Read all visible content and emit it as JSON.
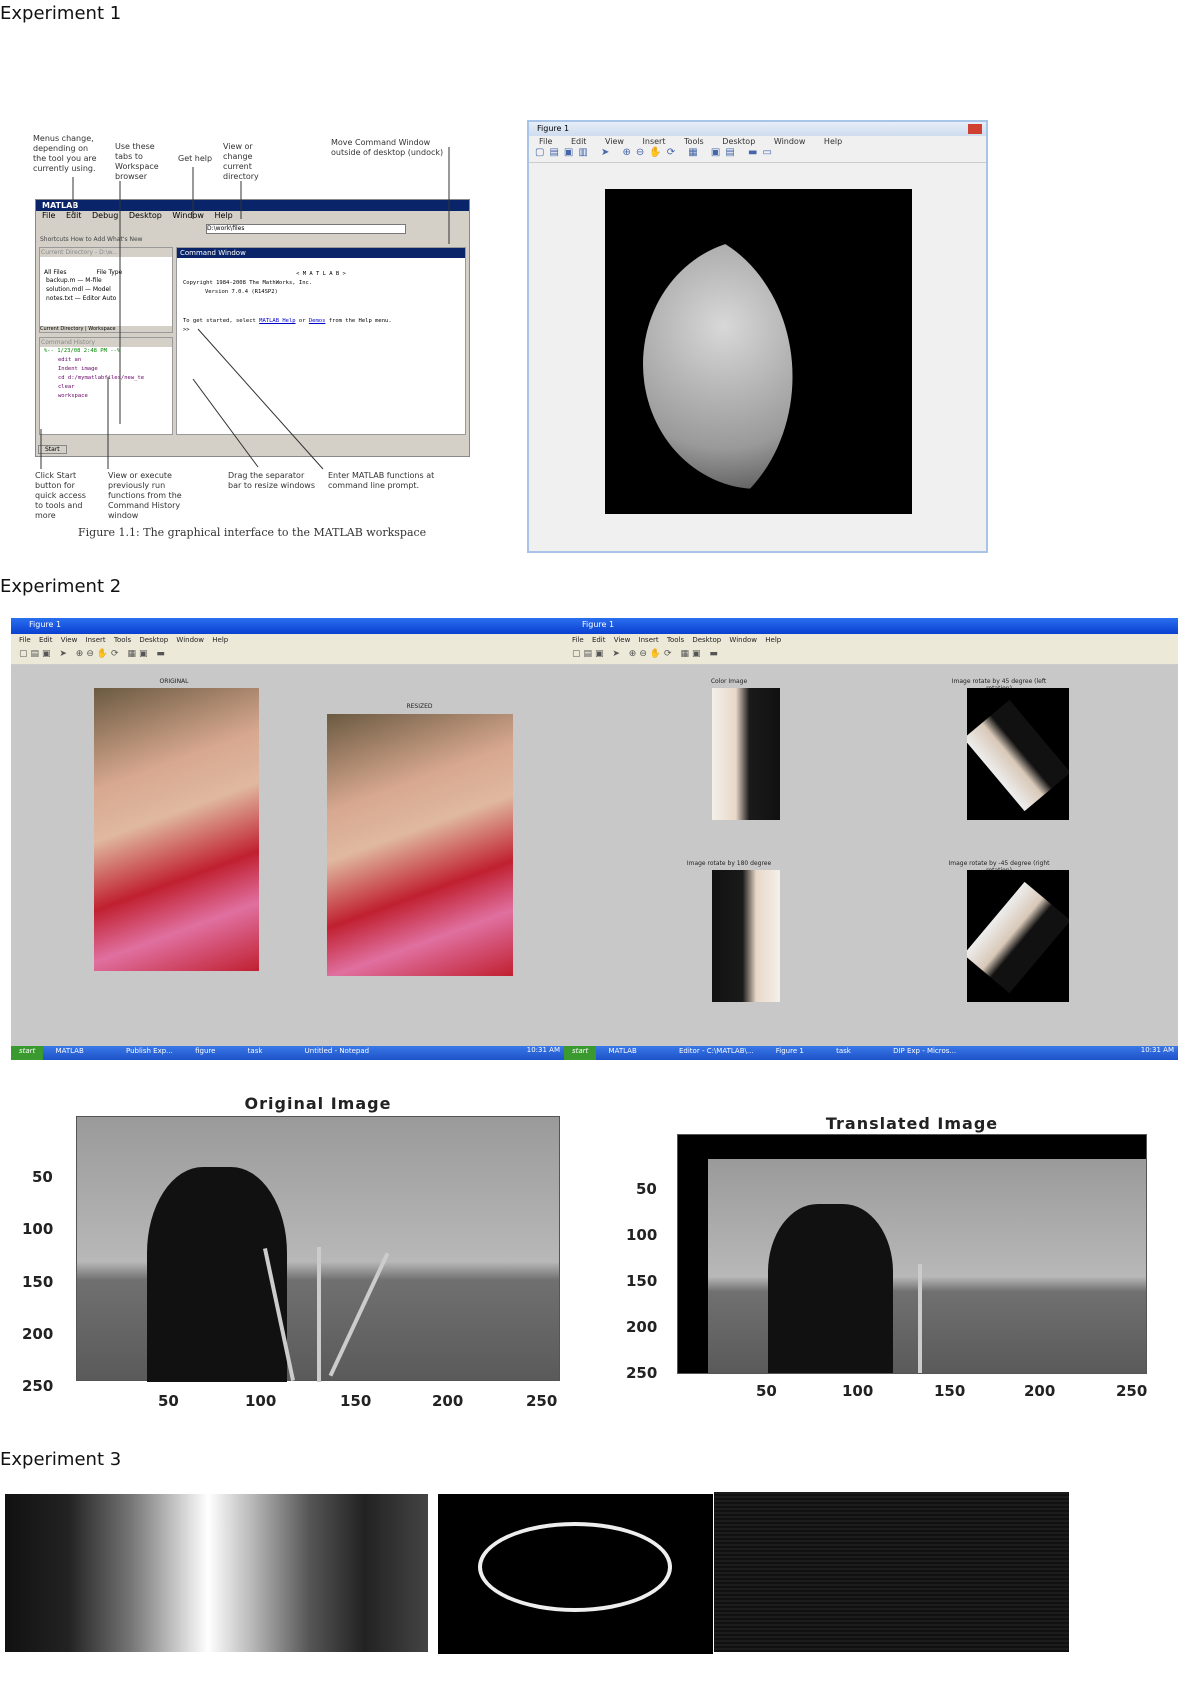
{
  "exp1": {
    "heading": "Experiment 1",
    "figure_caption": "Figure 1.1: The graphical interface to the MATLAB workspace",
    "annotations": [
      "Menus change, depending on the tool you are currently using.",
      "Use these tabs to Workspace browser",
      "Get help",
      "View or change current directory",
      "Move Command Window outside of desktop (undock)",
      "Click Start button for quick access to tools and more",
      "View or execute previously run functions from the Command History window",
      "Drag the separator bar to resize windows",
      "Enter MATLAB functions at command line prompt."
    ],
    "matlab": {
      "title": "MATLAB",
      "menus": [
        "File",
        "Edit",
        "Debug",
        "Desktop",
        "Window",
        "Help"
      ],
      "current_dir": "D:\\work\\files",
      "shortcuts": "Shortcuts  How to Add  What's New",
      "current_directory_title": "Current Directory - D:\\w...",
      "files_header": [
        "All Files",
        "File Type"
      ],
      "files": [
        [
          "backup.m",
          "M-file"
        ],
        [
          "solution.mdl",
          "Model"
        ],
        [
          "notes.txt",
          "Editor Auto"
        ]
      ],
      "tabs": [
        "Current Directory",
        "Workspace"
      ],
      "history_title": "Command History",
      "history": [
        "%-- 1/23/08  2:48 PM --%",
        "edit an",
        "Indent image",
        "cd d:/mymatlabfiles/new_te",
        "clear",
        "workspace"
      ],
      "command_title": "Command Window",
      "cmd_lines": [
        "< M A T L A B >",
        "Copyright 1984-2008 The MathWorks, Inc.",
        "Version 7.0.4 (R14SP2)"
      ],
      "cmd_start": "To get started, select",
      "link1": "MATLAB Help",
      "or": "or",
      "link2": "Demos",
      "from": "from the Help menu.",
      "prompt": ">>",
      "start": "Start"
    },
    "figure1": {
      "title": "Figure 1",
      "menus": [
        "File",
        "Edit",
        "View",
        "Insert",
        "Tools",
        "Desktop",
        "Window",
        "Help"
      ]
    }
  },
  "exp2": {
    "heading": "Experiment 2",
    "left_window": {
      "title": "Figure 1",
      "menus": "File Edit View Insert Tools Desktop Window Help",
      "captions": [
        "ORIGINAL",
        "RESIZED"
      ],
      "task_items": [
        "start",
        "MATLAB",
        "Publish Exp...",
        "figure",
        "task",
        "Untitled - Notepad"
      ],
      "clock": "10:31 AM"
    },
    "right_window": {
      "title": "Figure 1",
      "menus": "File Edit View Insert Tools Desktop Window Help",
      "captions": [
        "Color Image",
        "Image rotate by 45 degree (left rotation)",
        "Image rotate by 180 degree",
        "Image rotate by -45 degree (right rotation)"
      ],
      "task_items": [
        "start",
        "MATLAB",
        "Editor - C:\\MATLAB\\...",
        "Figure 1",
        "task",
        "DIP Exp - Micros..."
      ],
      "clock": "10:31 AM"
    },
    "original_plot": {
      "title": "Original Image",
      "xticks": [
        "50",
        "100",
        "150",
        "200",
        "250"
      ],
      "yticks": [
        "50",
        "100",
        "150",
        "200",
        "250"
      ]
    },
    "translated_plot": {
      "title": "Translated Image",
      "xticks": [
        "50",
        "100",
        "150",
        "200",
        "250"
      ],
      "yticks": [
        "50",
        "100",
        "150",
        "200",
        "250"
      ]
    }
  },
  "exp3": {
    "heading": "Experiment 3"
  }
}
